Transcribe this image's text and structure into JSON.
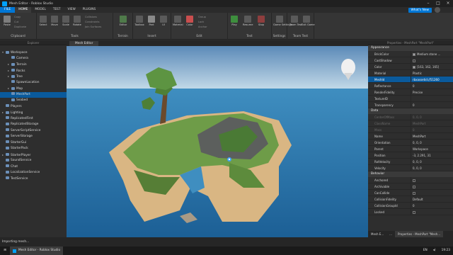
{
  "window": {
    "title": "Mesh Editor - Roblox Studio"
  },
  "menu": {
    "file": "FILE",
    "tabs": [
      "HOME",
      "MODEL",
      "TEST",
      "VIEW",
      "PLUGINS"
    ],
    "whats_new": "What's New"
  },
  "ribbon": {
    "groups": [
      "Clipboard",
      "Tools",
      "Terrain",
      "Insert",
      "Edit",
      "Test",
      "Settings",
      "Team Test"
    ],
    "buttons": [
      "Paste",
      "Select",
      "Move",
      "Scale",
      "Rotate",
      "Transform",
      "Editor",
      "Toolbox",
      "Part",
      "UI",
      "Material",
      "Color",
      "Group",
      "Lock",
      "Anchor",
      "Play",
      "Resume",
      "Stop",
      "Game Settings",
      "Team Test",
      "Exit Game"
    ],
    "small": [
      "Copy",
      "Cut",
      "Duplicate",
      "Collisions",
      "Constraints",
      "Join Surfaces",
      "Group",
      "Lock",
      "Anchor"
    ]
  },
  "explorer": {
    "title": "Explorer",
    "items": [
      {
        "label": "Workspace",
        "level": 0,
        "arrow": "▾"
      },
      {
        "label": "Camera",
        "level": 1,
        "arrow": ""
      },
      {
        "label": "Terrain",
        "level": 1,
        "arrow": "▸"
      },
      {
        "label": "Rocks",
        "level": 1,
        "arrow": "▸"
      },
      {
        "label": "Tree",
        "level": 1,
        "arrow": "▸"
      },
      {
        "label": "SpawnLocation",
        "level": 1,
        "arrow": ""
      },
      {
        "label": "Map",
        "level": 1,
        "arrow": "▸"
      },
      {
        "label": "MeshPart",
        "level": 1,
        "arrow": "",
        "selected": true
      },
      {
        "label": "Seabed",
        "level": 1,
        "arrow": ""
      },
      {
        "label": "Players",
        "level": 0,
        "arrow": ""
      },
      {
        "label": "Lighting",
        "level": 0,
        "arrow": "▸"
      },
      {
        "label": "ReplicatedFirst",
        "level": 0,
        "arrow": ""
      },
      {
        "label": "ReplicatedStorage",
        "level": 0,
        "arrow": ""
      },
      {
        "label": "ServerScriptService",
        "level": 0,
        "arrow": ""
      },
      {
        "label": "ServerStorage",
        "level": 0,
        "arrow": ""
      },
      {
        "label": "StarterGui",
        "level": 0,
        "arrow": ""
      },
      {
        "label": "StarterPack",
        "level": 0,
        "arrow": ""
      },
      {
        "label": "StarterPlayer",
        "level": 0,
        "arrow": "▸"
      },
      {
        "label": "SoundService",
        "level": 0,
        "arrow": ""
      },
      {
        "label": "Chat",
        "level": 0,
        "arrow": ""
      },
      {
        "label": "LocalizationService",
        "level": 0,
        "arrow": ""
      },
      {
        "label": "TestService",
        "level": 0,
        "arrow": ""
      }
    ]
  },
  "viewport": {
    "tab": "Mesh Editor"
  },
  "properties": {
    "title": "Properties - MeshPart \"MeshPart\"",
    "sections": [
      {
        "name": "Appearance",
        "rows": [
          {
            "k": "BrickColor",
            "v": "Medium stone ...",
            "swatch": "#a3a2a5"
          },
          {
            "k": "CastShadow",
            "v": "",
            "check": true
          },
          {
            "k": "Color",
            "v": "[163, 162, 165]",
            "swatch": "#a3a2a5"
          },
          {
            "k": "Material",
            "v": "Plastic"
          },
          {
            "k": "MeshId",
            "v": "rbxassetid://51260",
            "selected": true
          },
          {
            "k": "Reflectance",
            "v": "0"
          },
          {
            "k": "RenderFidelity",
            "v": "Precise"
          },
          {
            "k": "TextureID",
            "v": ""
          },
          {
            "k": "Transparency",
            "v": "0"
          }
        ]
      },
      {
        "name": "Data",
        "rows": [
          {
            "k": "CenterOfMass",
            "v": "0, 0, 0",
            "dim": true
          },
          {
            "k": "ClassName",
            "v": "MeshPart",
            "dim": true
          },
          {
            "k": "Mass",
            "v": "0",
            "dim": true
          },
          {
            "k": "Name",
            "v": "MeshPart"
          },
          {
            "k": "Orientation",
            "v": "0, 0, 0"
          },
          {
            "k": "Parent",
            "v": "Workspace"
          },
          {
            "k": "Position",
            "v": "-3, 2.291, 31"
          },
          {
            "k": "RotVelocity",
            "v": "0, 0, 0"
          },
          {
            "k": "Velocity",
            "v": "0, 0, 0"
          }
        ]
      },
      {
        "name": "Behavior",
        "rows": [
          {
            "k": "Anchored",
            "v": "",
            "check": true
          },
          {
            "k": "Archivable",
            "v": "",
            "check": true
          },
          {
            "k": "CanCollide",
            "v": "",
            "check": true
          },
          {
            "k": "CollisionFidelity",
            "v": "Default"
          },
          {
            "k": "CollisionGroupId",
            "v": "0"
          },
          {
            "k": "Locked",
            "v": "",
            "check": true
          }
        ]
      }
    ],
    "bottom_tabs": [
      "Mesh E...",
      "...",
      "Properties - MeshPart \"Mesh..."
    ]
  },
  "status": {
    "text": "Importing mesh..."
  },
  "taskbar": {
    "app": "Mesh Editor - Roblox Studio",
    "lang": "EN",
    "time": "19:23"
  },
  "colors": {
    "accent": "#0077d6",
    "sky_top": "#5f8fbf",
    "sky_bottom": "#cfe3ee",
    "ocean": "#1d6fa5",
    "sand": "#d8b784",
    "grass": "#5f8d3e"
  }
}
